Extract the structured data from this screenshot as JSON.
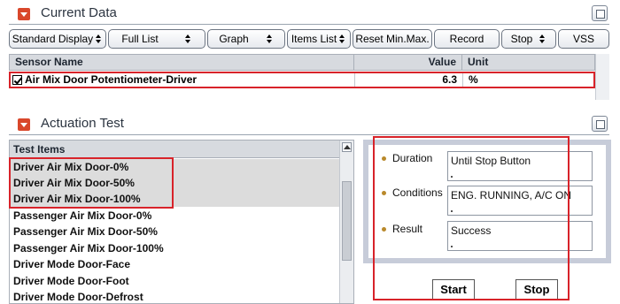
{
  "current_data": {
    "title": "Current Data",
    "toolbar": {
      "standard_display": "Standard Display",
      "full_list": "Full List",
      "graph": "Graph",
      "items_list": "Items List",
      "reset_min_max": "Reset Min.Max.",
      "record": "Record",
      "stop": "Stop",
      "vss": "VSS"
    },
    "columns": {
      "sensor_name": "Sensor Name",
      "value": "Value",
      "unit": "Unit"
    },
    "rows": [
      {
        "name": "Air Mix Door Potentiometer-Driver",
        "value": "6.3",
        "unit": "%",
        "checked": true
      }
    ]
  },
  "actuation_test": {
    "title": "Actuation Test",
    "list_header": "Test Items",
    "items": [
      "Driver Air Mix Door-0%",
      "Driver Air Mix Door-50%",
      "Driver Air Mix Door-100%",
      "Passenger Air Mix Door-0%",
      "Passenger Air Mix Door-50%",
      "Passenger Air Mix Door-100%",
      "Driver Mode Door-Face",
      "Driver Mode Door-Foot",
      "Driver Mode Door-Defrost"
    ],
    "selected_index": 0,
    "detail": {
      "duration_label": "Duration",
      "duration_value": "Until Stop Button",
      "conditions_label": "Conditions",
      "conditions_value": "ENG. RUNNING, A/C ON",
      "result_label": "Result",
      "result_value": "Success"
    },
    "buttons": {
      "start": "Start",
      "stop": "Stop"
    }
  },
  "colors": {
    "highlight_outline": "#d8232a",
    "collapse_button": "#d9472b",
    "bullet": "#b9892b"
  }
}
